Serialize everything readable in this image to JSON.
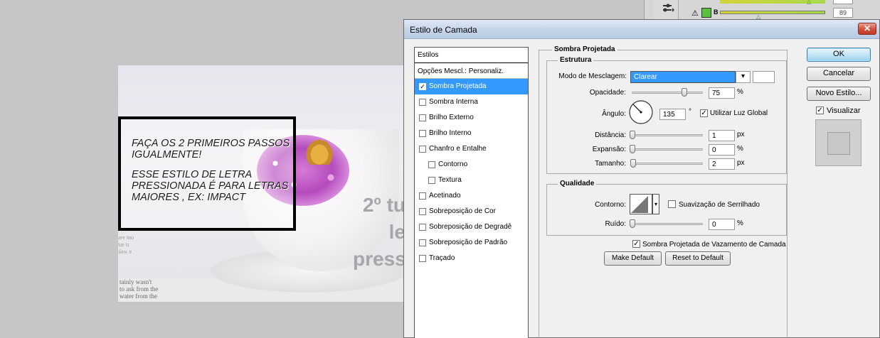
{
  "canvas": {
    "note_line1": "FAÇA OS 2 PRIMEIROS PASSOS IGUALMENTE!",
    "note_line2": "ESSE ESTILO DE LETRA PRESSIONADA É PARA LETRAS MAIORES , EX: IMPACT",
    "big_text": "2º tu\nle\npress"
  },
  "panel": {
    "channel_label": "B",
    "channel_value": "89"
  },
  "dialog": {
    "title": "Estilo de Camada",
    "close": "✕",
    "styles_header": "Estilos",
    "blend_options": "Opções Mescl.: Personaliz.",
    "styles": [
      {
        "label": "Sombra Projetada",
        "checked": true,
        "selected": true
      },
      {
        "label": "Sombra Interna",
        "checked": false
      },
      {
        "label": "Brilho Externo",
        "checked": false
      },
      {
        "label": "Brilho Interno",
        "checked": false
      },
      {
        "label": "Chanfro e Entalhe",
        "checked": false
      },
      {
        "label": "Contorno",
        "checked": false,
        "sub": true
      },
      {
        "label": "Textura",
        "checked": false,
        "sub": true
      },
      {
        "label": "Acetinado",
        "checked": false
      },
      {
        "label": "Sobreposição de Cor",
        "checked": false
      },
      {
        "label": "Sobreposição de Degradê",
        "checked": false
      },
      {
        "label": "Sobreposição de Padrão",
        "checked": false
      },
      {
        "label": "Traçado",
        "checked": false
      }
    ],
    "section_title": "Sombra Projetada",
    "structure": {
      "title": "Estrutura",
      "blend_mode_label": "Modo de Mesclagem:",
      "blend_mode_value": "Clarear",
      "blend_color": "#ffffff",
      "opacity_label": "Opacidade:",
      "opacity_value": "75",
      "opacity_unit": "%",
      "angle_label": "Ângulo:",
      "angle_value": "135",
      "angle_unit": "°",
      "global_light_label": "Utilizar Luz Global",
      "distance_label": "Distância:",
      "distance_value": "1",
      "distance_unit": "px",
      "spread_label": "Expansão:",
      "spread_value": "0",
      "spread_unit": "%",
      "size_label": "Tamanho:",
      "size_value": "2",
      "size_unit": "px"
    },
    "quality": {
      "title": "Qualidade",
      "contour_label": "Contorno:",
      "antialias_label": "Suavização de Serrilhado",
      "noise_label": "Ruído:",
      "noise_value": "0",
      "noise_unit": "%"
    },
    "knockout_label": "Sombra Projetada de Vazamento de Camada",
    "make_default": "Make Default",
    "reset_default": "Reset to Default",
    "ok": "OK",
    "cancel": "Cancelar",
    "new_style": "Novo Estilo...",
    "preview_label": "Visualizar"
  },
  "colors": {
    "selection": "#3399ff",
    "slider_b": "#a8d84a"
  }
}
